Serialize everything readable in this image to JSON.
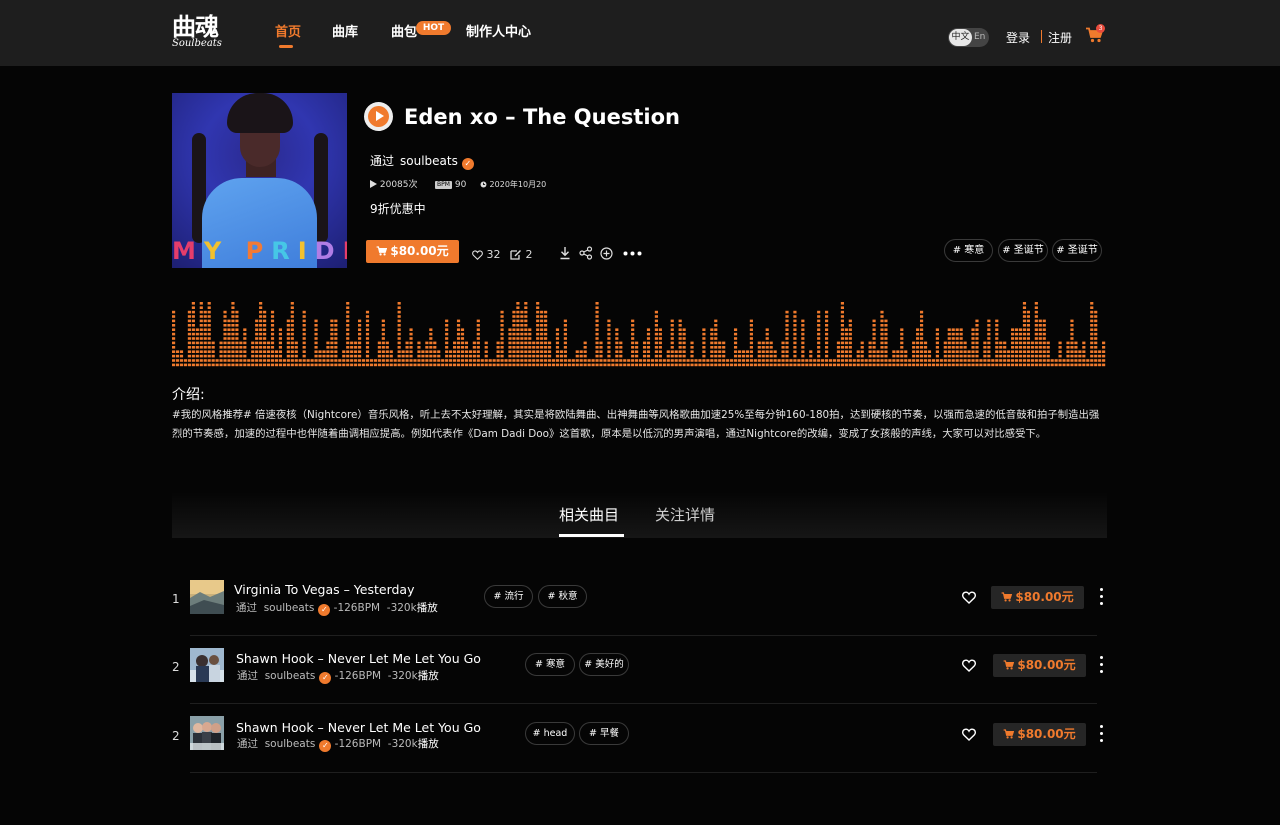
{
  "header": {
    "logo_cn": "曲魂",
    "logo_en": "Soulbeats",
    "nav": [
      {
        "label": "首页",
        "active": true
      },
      {
        "label": "曲库",
        "active": false
      },
      {
        "label": "曲包",
        "active": false
      },
      {
        "label": "制作人中心",
        "active": false
      }
    ],
    "hot_badge": "HOT",
    "lang": {
      "zh": "中文",
      "en": "En"
    },
    "login": "登录",
    "register": "注册",
    "cart_count": "3",
    "accent": "#f07a2d"
  },
  "track": {
    "title": "Eden xo – The Question",
    "by_label": "通过",
    "artist": "soulbeats",
    "plays": "20085次",
    "bpm_label": "BPM",
    "bpm": "90",
    "date": "2020年10月20",
    "discount": "9折优惠中",
    "price": "$80.00元",
    "likes": "32",
    "shares": "2",
    "tags": [
      "# 寒意",
      "# 圣诞节",
      "# 圣诞节"
    ],
    "cover_text": "MY PRIDE"
  },
  "waveform": {
    "levels": [
      6,
      2,
      2,
      1,
      6,
      7,
      4,
      7,
      6,
      7,
      3,
      1,
      3,
      6,
      5,
      7,
      6,
      3,
      4,
      1,
      3,
      5,
      7,
      6,
      3,
      6,
      2,
      4,
      1,
      5,
      7,
      3,
      1,
      6,
      1,
      1,
      5,
      2,
      2,
      3,
      5,
      5,
      1,
      2,
      7,
      3,
      3,
      5,
      1,
      6,
      1,
      1,
      3,
      5,
      3,
      2,
      1,
      7,
      2,
      3,
      4,
      1,
      3,
      2,
      3,
      4,
      3,
      2,
      1,
      5,
      2,
      3,
      5,
      4,
      3,
      2,
      3,
      5,
      1,
      3,
      1,
      1,
      3,
      6,
      1,
      4,
      6,
      7,
      6,
      7,
      4,
      3,
      7,
      6,
      6,
      3,
      1,
      4,
      2,
      5,
      1,
      1,
      2,
      2,
      3,
      1,
      1,
      7,
      3,
      1,
      5,
      1,
      4,
      3,
      1,
      1,
      5,
      3,
      1,
      3,
      4,
      1,
      6,
      4,
      1,
      2,
      5,
      2,
      5,
      4,
      1,
      3,
      1,
      1,
      4,
      1,
      4,
      5,
      3,
      3,
      1,
      1,
      4,
      2,
      2,
      2,
      5,
      1,
      3,
      3,
      4,
      3,
      2,
      1,
      3,
      6,
      1,
      6,
      1,
      5,
      1,
      2,
      1,
      6,
      1,
      6,
      1,
      1,
      3,
      7,
      4,
      5,
      1,
      2,
      3,
      1,
      3,
      5,
      2,
      6,
      5,
      1,
      2,
      2,
      4,
      2,
      1,
      3,
      4,
      6,
      3,
      2,
      1,
      4,
      1,
      3,
      4,
      4,
      4,
      4,
      3,
      2,
      4,
      5,
      1,
      3,
      5,
      1,
      5,
      3,
      3,
      2,
      4,
      4,
      4,
      7,
      6,
      3,
      7,
      5,
      5,
      3,
      1,
      1,
      3,
      1,
      3,
      5,
      3,
      2,
      3,
      1,
      7,
      6,
      2,
      3
    ]
  },
  "intro": {
    "label": "介绍:",
    "text": "#我的风格推荐# 倍速夜核（Nightcore）音乐风格，听上去不太好理解，其实是将欧陆舞曲、出神舞曲等风格歌曲加速25%至每分钟160-180拍，达到硬核的节奏，以强而急速的低音鼓和拍子制造出强烈的节奏感，加速的过程中也伴随着曲调相应提高。例如代表作《Dam Dadi Doo》这首歌，原本是以低沉的男声演唱，通过Nightcore的改编，变成了女孩般的声线，大家可以对比感受下。"
  },
  "tabs": [
    {
      "label": "相关曲目",
      "active": true
    },
    {
      "label": "关注详情",
      "active": false
    }
  ],
  "songs": [
    {
      "index": "1",
      "title": "Virginia To Vegas – Yesterday",
      "by_label": "通过",
      "artist": "soulbeats",
      "bpm": "-126BPM",
      "plays": "-320k",
      "play_word": "播放",
      "tags": [
        "# 流行",
        "# 秋意"
      ],
      "price": "$80.00元"
    },
    {
      "index": "2",
      "title": "Shawn Hook – Never Let Me Let You Go",
      "by_label": "通过",
      "artist": "soulbeats",
      "bpm": "-126BPM",
      "plays": "-320k",
      "play_word": "播放",
      "tags": [
        "# 寒意",
        "# 美好的"
      ],
      "price": "$80.00元"
    },
    {
      "index": "2",
      "title": "Shawn Hook – Never Let Me Let You Go",
      "by_label": "通过",
      "artist": "soulbeats",
      "bpm": "-126BPM",
      "plays": "-320k",
      "play_word": "播放",
      "tags": [
        "# head",
        "# 早餐"
      ],
      "price": "$80.00元"
    }
  ]
}
